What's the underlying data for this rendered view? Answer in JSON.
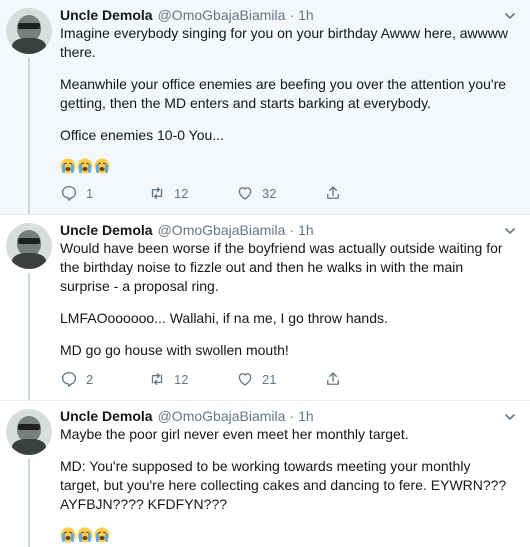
{
  "colors": {
    "text": "#14171a",
    "muted": "#657786",
    "border": "#e6ecf0",
    "highlight_bg": "#f5f8fa"
  },
  "tweets": [
    {
      "name": "Uncle Demola",
      "handle": "@OmoGbajaBiamila",
      "separator": "·",
      "time": "1h",
      "paragraphs": [
        "Imagine everybody singing for you on your birthday Awww here, awwww there.",
        "Meanwhile your office enemies are beefing you over the attention you're getting, then the MD enters and starts barking at everybody.",
        "Office enemies 10-0 You..."
      ],
      "emojis": [
        "loudly-crying-face",
        "loudly-crying-face",
        "loudly-crying-face"
      ],
      "replies": "1",
      "retweets": "12",
      "likes": "32"
    },
    {
      "name": "Uncle Demola",
      "handle": "@OmoGbajaBiamila",
      "separator": "·",
      "time": "1h",
      "paragraphs": [
        "Would have been worse if the boyfriend was actually outside waiting for the birthday noise to fizzle out and then he walks in with the main surprise - a proposal ring.",
        "LMFAOoooooo... Wallahi, if na me, I go throw hands.",
        "MD go go house with swollen mouth!"
      ],
      "emojis": [],
      "replies": "2",
      "retweets": "12",
      "likes": "21"
    },
    {
      "name": "Uncle Demola",
      "handle": "@OmoGbajaBiamila",
      "separator": "·",
      "time": "1h",
      "paragraphs": [
        "Maybe the poor girl never even meet her monthly target.",
        "MD: You're supposed to be working towards meeting your monthly target, but you're here collecting cakes and dancing to fere. EYWRN??? AYFBJN???? KFDFYN???"
      ],
      "emojis": [
        "loudly-crying-face",
        "loudly-crying-face",
        "loudly-crying-face"
      ],
      "replies": "",
      "retweets": "",
      "likes": ""
    }
  ]
}
